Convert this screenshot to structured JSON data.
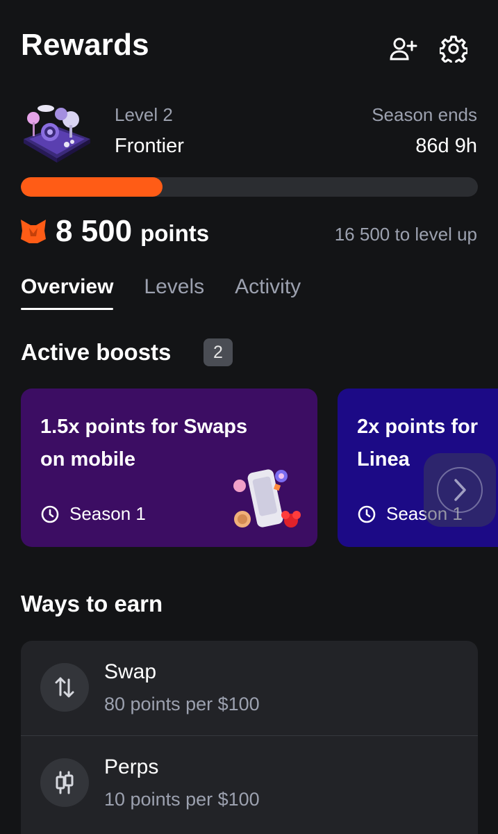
{
  "header": {
    "title": "Rewards",
    "icons": [
      "add-user-icon",
      "gear-icon"
    ]
  },
  "level": {
    "label": "Level 2",
    "name": "Frontier",
    "season_label": "Season ends",
    "season_value": "86d 9h",
    "progress_fraction": 0.31
  },
  "points": {
    "value": "8 500",
    "unit": "points",
    "to_level_up": "16 500 to level up"
  },
  "tabs": [
    {
      "label": "Overview",
      "active": true
    },
    {
      "label": "Levels",
      "active": false
    },
    {
      "label": "Activity",
      "active": false
    }
  ],
  "boosts": {
    "title": "Active boosts",
    "count": "2",
    "items": [
      {
        "title_line1": "1.5x points for Swaps",
        "title_line2": "on mobile",
        "season": "Season 1",
        "color": "#3c0d63"
      },
      {
        "title_line1": "2x points for",
        "title_line2": "Linea",
        "season": "Season 1",
        "color": "#1c0a86"
      }
    ]
  },
  "earn": {
    "title": "Ways to earn",
    "items": [
      {
        "name": "Swap",
        "desc": "80 points per $100",
        "icon": "swap-arrows-icon"
      },
      {
        "name": "Perps",
        "desc": "10 points per $100",
        "icon": "candlestick-icon"
      }
    ]
  },
  "colors": {
    "background": "#131416",
    "accent": "#ff5c16",
    "muted_text": "#9ca1af",
    "card": "#222327"
  }
}
